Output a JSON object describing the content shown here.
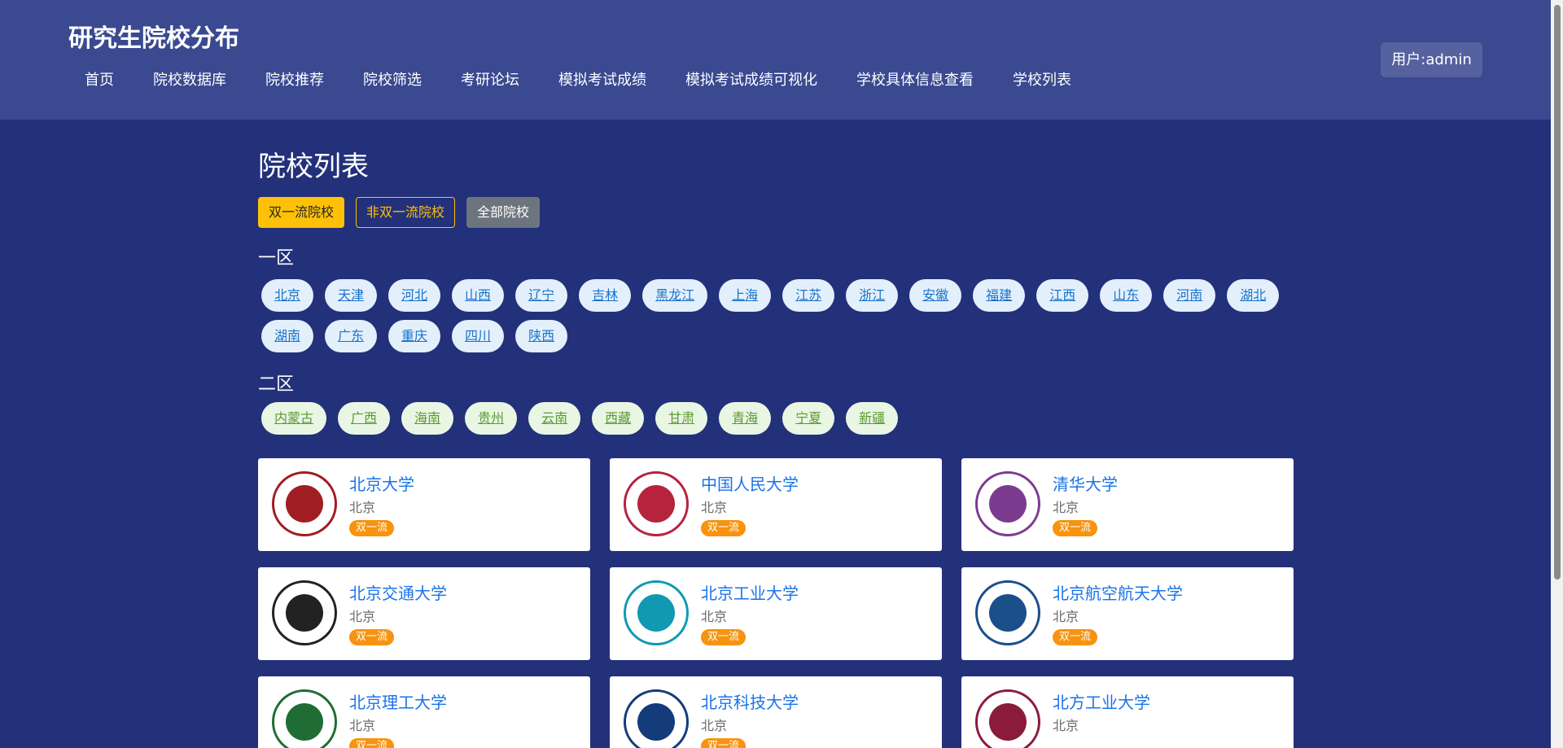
{
  "header": {
    "site_title": "研究生院校分布",
    "nav": [
      "首页",
      "院校数据库",
      "院校推荐",
      "院校筛选",
      "考研论坛",
      "模拟考试成绩",
      "模拟考试成绩可视化",
      "学校具体信息查看",
      "学校列表"
    ],
    "user": "用户:admin"
  },
  "main": {
    "page_title": "院校列表",
    "filters": [
      "双一流院校",
      "非双一流院校",
      "全部院校"
    ],
    "region1": {
      "title": "一区",
      "provinces": [
        "北京",
        "天津",
        "河北",
        "山西",
        "辽宁",
        "吉林",
        "黑龙江",
        "上海",
        "江苏",
        "浙江",
        "安徽",
        "福建",
        "江西",
        "山东",
        "河南",
        "湖北",
        "湖南",
        "广东",
        "重庆",
        "四川",
        "陕西"
      ]
    },
    "region2": {
      "title": "二区",
      "provinces": [
        "内蒙古",
        "广西",
        "海南",
        "贵州",
        "云南",
        "西藏",
        "甘肃",
        "青海",
        "宁夏",
        "新疆"
      ]
    },
    "schools": [
      {
        "name": "北京大学",
        "location": "北京",
        "badge": "双一流",
        "logo_color": "#a01d22"
      },
      {
        "name": "中国人民大学",
        "location": "北京",
        "badge": "双一流",
        "logo_color": "#b5233d"
      },
      {
        "name": "清华大学",
        "location": "北京",
        "badge": "双一流",
        "logo_color": "#7b3c8f"
      },
      {
        "name": "北京交通大学",
        "location": "北京",
        "badge": "双一流",
        "logo_color": "#222222"
      },
      {
        "name": "北京工业大学",
        "location": "北京",
        "badge": "双一流",
        "logo_color": "#1199b2"
      },
      {
        "name": "北京航空航天大学",
        "location": "北京",
        "badge": "双一流",
        "logo_color": "#1b4f8a"
      },
      {
        "name": "北京理工大学",
        "location": "北京",
        "badge": "双一流",
        "logo_color": "#1f6d34"
      },
      {
        "name": "北京科技大学",
        "location": "北京",
        "badge": "双一流",
        "logo_color": "#143b7a"
      },
      {
        "name": "北方工业大学",
        "location": "北京",
        "badge": "",
        "logo_color": "#8a1c3a"
      }
    ]
  }
}
